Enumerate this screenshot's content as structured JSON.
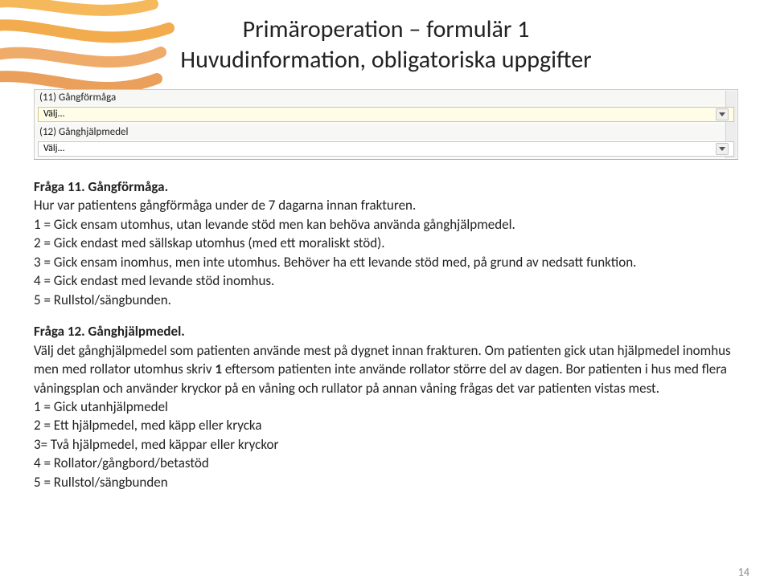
{
  "title": {
    "line1": "Primäroperation – formulär 1",
    "line2": "Huvudinformation, obligatoriska uppgifter"
  },
  "form": {
    "q11_label": "(11) Gångförmåga",
    "q12_label": "(12) Gånghjälpmedel",
    "select_placeholder": "Välj..."
  },
  "q11": {
    "heading": "Fråga 11. Gångförmåga.",
    "intro": "Hur var patientens gångförmåga under de 7 dagarna innan frakturen.",
    "o1": "1 = Gick ensam utomhus, utan levande stöd men kan behöva använda gånghjälpmedel.",
    "o2": "2 = Gick endast med sällskap utomhus (med ett moraliskt stöd).",
    "o3": "3 = Gick ensam inomhus, men inte utomhus. Behöver ha ett levande stöd med, på grund av nedsatt funktion.",
    "o4": "4 = Gick endast med levande stöd inomhus.",
    "o5": "5 = Rullstol/sängbunden."
  },
  "q12": {
    "heading": "Fråga 12. Gånghjälpmedel.",
    "para": "Välj det gånghjälpmedel som patienten använde mest på dygnet innan frakturen. Om patienten gick utan hjälpmedel inomhus men med rollator utomhus skriv 1 eftersom patienten inte använde rollator större del av dagen. Bor patienten i hus med flera våningsplan och använder kryckor på en våning och rullator på annan våning frågas det var patienten vistas mest.",
    "bold_word": "1",
    "o1": "1 = Gick utanhjälpmedel",
    "o2": "2 = Ett hjälpmedel, med käpp eller krycka",
    "o3": "3= Två hjälpmedel, med käppar eller kryckor",
    "o4": "4 = Rollator/gångbord/betastöd",
    "o5": "5 = Rullstol/sängbunden"
  },
  "page_number": "14"
}
